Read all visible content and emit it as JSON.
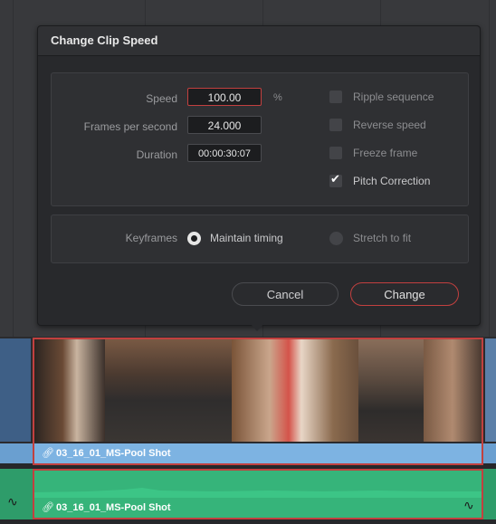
{
  "dialog": {
    "title": "Change Clip Speed",
    "speed_label": "Speed",
    "speed_value": "100.00",
    "speed_unit": "%",
    "fps_label": "Frames per second",
    "fps_value": "24.000",
    "duration_label": "Duration",
    "duration_value": "00:00:30:07",
    "options": [
      {
        "label": "Ripple sequence",
        "checked": false
      },
      {
        "label": "Reverse speed",
        "checked": false
      },
      {
        "label": "Freeze frame",
        "checked": false
      },
      {
        "label": "Pitch Correction",
        "checked": true
      }
    ],
    "keyframes_label": "Keyframes",
    "keyframes_options": [
      {
        "label": "Maintain timing",
        "selected": true
      },
      {
        "label": "Stretch to fit",
        "selected": false
      }
    ],
    "cancel_label": "Cancel",
    "change_label": "Change"
  },
  "timeline": {
    "video_clip_name": "03_16_01_MS-Pool Shot",
    "audio_clip_name": "03_16_01_MS-Pool Shot"
  },
  "colors": {
    "accent": "#c2403f",
    "video_track": "#7db3e2",
    "audio_track": "#36b47a"
  }
}
